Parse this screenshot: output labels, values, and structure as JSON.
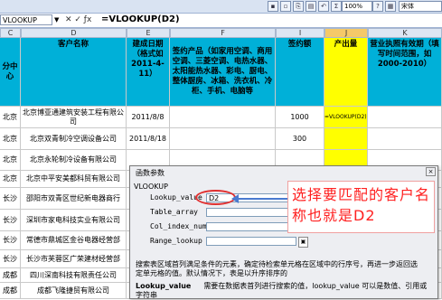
{
  "toolbar": {
    "zoom": "100%",
    "font": "宋体",
    "icons": [
      "save-icon",
      "print-icon",
      "copy-icon",
      "paste-icon",
      "undo-icon",
      "redo-icon",
      "sum-icon",
      "sort-icon",
      "chart-icon",
      "help-icon"
    ]
  },
  "formula_bar": {
    "name_box": "VLOOKUP",
    "fx_symbols": "✕ ✓ ƒx",
    "formula": "=VLOOKUP(D2)"
  },
  "columns": [
    "C",
    "D",
    "E",
    "F",
    "I",
    "J",
    "K"
  ],
  "header_row": {
    "c": "分中心",
    "d": "客户名称",
    "e": "建成日期（格式如2011-4-11）",
    "f": "签约产品（如家用空调、商用空调、三菱空调、电热水器、太阳能热水器、彩电、厨电、整体厨房、冰箱、洗衣机、冷柜、手机、电脑等",
    "i": "签约额",
    "j": "产出量",
    "k": "营业执照有效期（填写时间范围，如2000-2010）"
  },
  "rows": [
    {
      "c": "北京",
      "d": "北京博亚通建筑安装工程有限公司",
      "e": "2011/8/8",
      "i": "1000",
      "j": "=VLOOKUP(D2)"
    },
    {
      "c": "北京",
      "d": "北京双青制冷空调设备公司",
      "e": "2011/8/18",
      "i": "300",
      "j": ""
    },
    {
      "c": "北京",
      "d": "北京永轮制冷设备有限公司",
      "e": "",
      "i": "",
      "j": ""
    },
    {
      "c": "北京",
      "d": "北京中平安美都科贸有限公司",
      "e": "",
      "i": "",
      "j": ""
    },
    {
      "c": "长沙",
      "d": "邵阳市双青区世纪新电器商行",
      "e": "",
      "i": "",
      "j": ""
    },
    {
      "c": "长沙",
      "d": "深圳市家电科技实业有限公司",
      "e": "",
      "i": "",
      "j": ""
    },
    {
      "c": "长沙",
      "d": "常德市鼎城区金谷电器经营部",
      "e": "",
      "i": "",
      "j": ""
    },
    {
      "c": "长沙",
      "d": "长沙市芙蓉区广荣建材经营部",
      "e": "",
      "i": "",
      "j": ""
    },
    {
      "c": "成都",
      "d": "四川深南科技有限责任公司",
      "e": "",
      "i": "",
      "j": ""
    },
    {
      "c": "成都",
      "d": "成都飞隆捷贸有限公司",
      "e": "",
      "i": "",
      "j": ""
    }
  ],
  "dialog": {
    "title": "函数参数",
    "close": "×",
    "group": "VLOOKUP",
    "fields": [
      {
        "label": "Lookup_value",
        "value": "D2"
      },
      {
        "label": "Table_array",
        "value": ""
      },
      {
        "label": "Col_index_num",
        "value": ""
      },
      {
        "label": "Range_lookup",
        "value": ""
      }
    ],
    "description": "搜索表区域首列满足条件的元素，确定待检索单元格在区域中的行序号，再进一步返回选定单元格的值。默认情况下，表是以升序排序的",
    "param_name": "Lookup_value",
    "param_desc": "需要在数据表首列进行搜索的值，lookup_value 可以是数值、引用或字符串"
  },
  "annotation": {
    "text": "选择要匹配的客户名称也就是D2",
    "color": "#ff2020"
  }
}
